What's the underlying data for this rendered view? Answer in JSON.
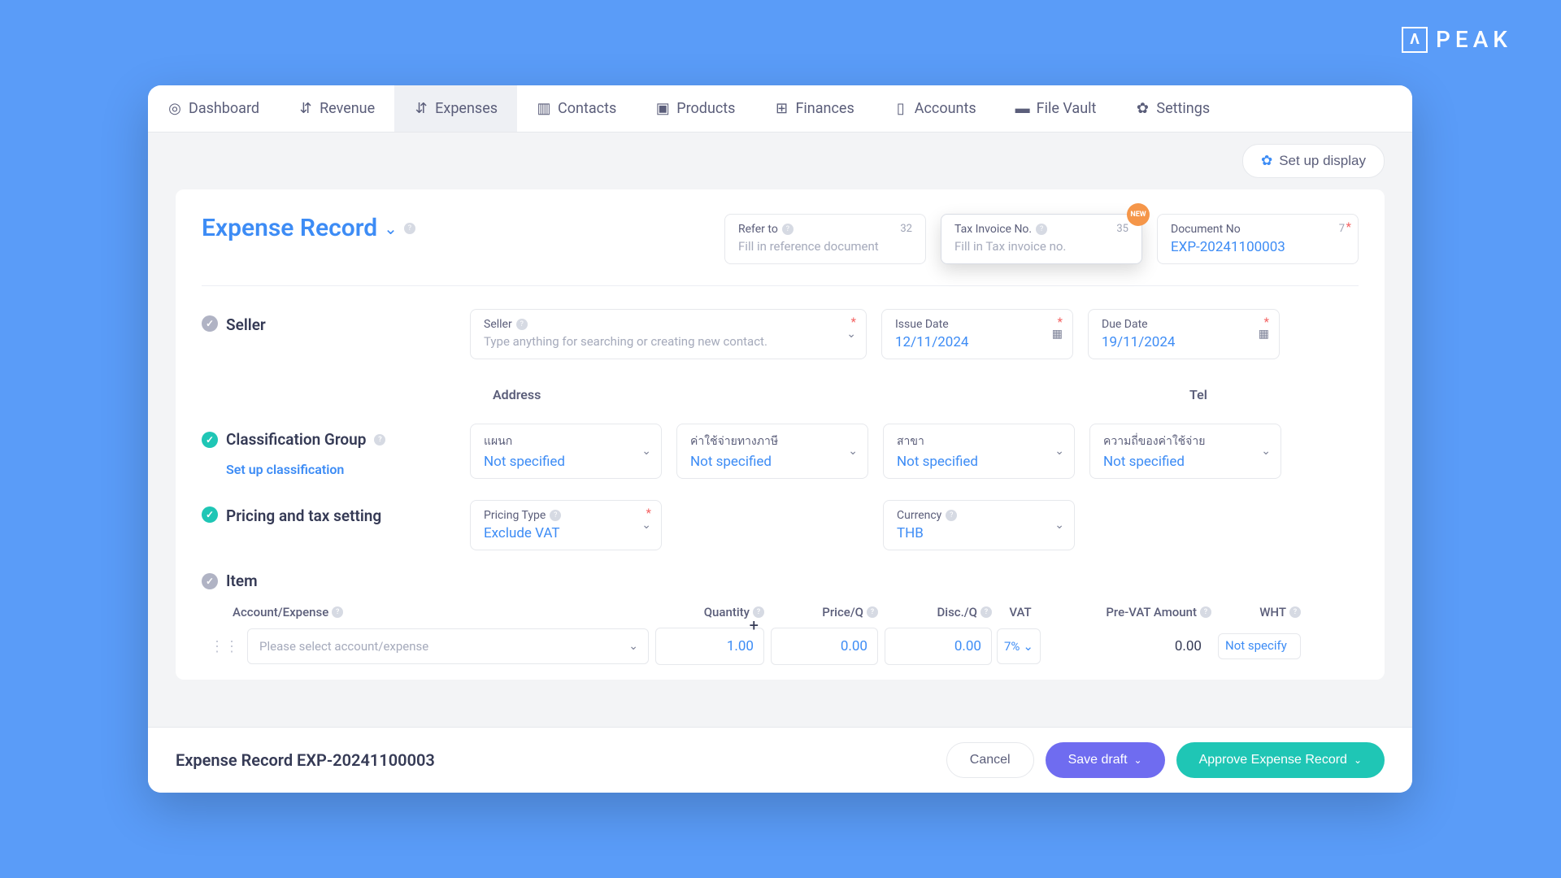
{
  "brand": {
    "name": "PEAK",
    "icon": "Λ"
  },
  "nav": {
    "items": [
      {
        "label": "Dashboard",
        "active": false
      },
      {
        "label": "Revenue",
        "active": false
      },
      {
        "label": "Expenses",
        "active": true
      },
      {
        "label": "Contacts",
        "active": false
      },
      {
        "label": "Products",
        "active": false
      },
      {
        "label": "Finances",
        "active": false
      },
      {
        "label": "Accounts",
        "active": false
      },
      {
        "label": "File Vault",
        "active": false
      },
      {
        "label": "Settings",
        "active": false
      }
    ]
  },
  "toolbar": {
    "setup_display": "Set up display"
  },
  "header": {
    "title": "Expense Record",
    "refer": {
      "label": "Refer to",
      "count": "32",
      "placeholder": "Fill in reference document"
    },
    "tax_inv": {
      "label": "Tax Invoice No.",
      "count": "35",
      "placeholder": "Fill in Tax invoice no.",
      "badge": "NEW"
    },
    "docno": {
      "label": "Document No",
      "count": "7",
      "value": "EXP-20241100003"
    }
  },
  "seller": {
    "section": "Seller",
    "field_label": "Seller",
    "placeholder": "Type anything for searching or creating new contact.",
    "issue_label": "Issue Date",
    "issue_value": "12/11/2024",
    "due_label": "Due Date",
    "due_value": "19/11/2024",
    "address_label": "Address",
    "tel_label": "Tel"
  },
  "classification": {
    "section": "Classification Group",
    "setup_link": "Set up classification",
    "fields": [
      {
        "label": "แผนก",
        "value": "Not specified"
      },
      {
        "label": "ค่าใช้จ่ายทางภาษี",
        "value": "Not specified"
      },
      {
        "label": "สาขา",
        "value": "Not specified"
      },
      {
        "label": "ความถี่ของค่าใช้จ่าย",
        "value": "Not specified"
      }
    ]
  },
  "pricing": {
    "section": "Pricing and tax setting",
    "type_label": "Pricing Type",
    "type_value": "Exclude VAT",
    "currency_label": "Currency",
    "currency_value": "THB"
  },
  "items": {
    "section": "Item",
    "columns": {
      "account": "Account/Expense",
      "qty": "Quantity",
      "price": "Price/Q",
      "disc": "Disc./Q",
      "vat": "VAT",
      "prevat": "Pre-VAT Amount",
      "wht": "WHT"
    },
    "row": {
      "account_placeholder": "Please select account/expense",
      "qty": "1.00",
      "price": "0.00",
      "disc": "0.00",
      "vat": "7%",
      "prevat": "0.00",
      "wht": "Not specify"
    }
  },
  "footer": {
    "title": "Expense Record EXP-20241100003",
    "cancel": "Cancel",
    "draft": "Save draft",
    "approve": "Approve Expense Record"
  }
}
